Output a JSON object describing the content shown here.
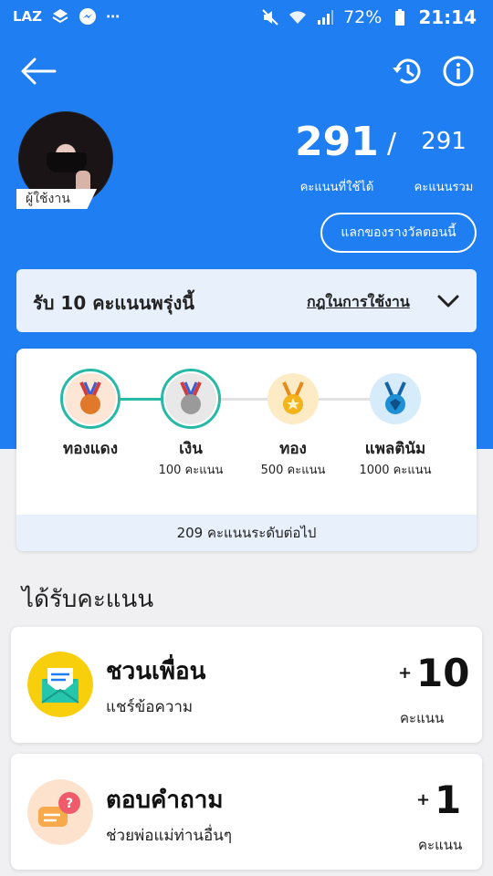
{
  "status_bar": {
    "time": "21:14",
    "battery": "72%",
    "carrier": "LAZ"
  },
  "profile": {
    "username": "ผู้ใช้งาน",
    "points_usable": "291",
    "separator": "/",
    "points_total": "291",
    "label_usable": "คะแนนที่ใช้ได้",
    "label_total": "คะแนนรวม",
    "redeem_label": "แลกของรางวัลตอนนี้"
  },
  "tomorrow": {
    "title": "รับ 10 คะแนนพรุ่งนี้",
    "rules_link": "กฎในการใช้งาน"
  },
  "tiers": [
    {
      "name": "ทองแดง",
      "points": "",
      "active": true,
      "color": "#e07a2a"
    },
    {
      "name": "เงิน",
      "points": "100 คะแนน",
      "active": true,
      "color": "#9a9a9a"
    },
    {
      "name": "ทอง",
      "points": "500 คะแนน",
      "active": false,
      "color": "#f2b31b"
    },
    {
      "name": "แพลตินัม",
      "points": "1000 คะแนน",
      "active": false,
      "color": "#1f8fd6"
    }
  ],
  "next_level": "209 คะแนนระดับต่อไป",
  "section_title": "ได้รับคะแนน",
  "earn_items": [
    {
      "title": "ชวนเพื่อน",
      "subtitle": "แชร์ข้อความ",
      "plus": "+",
      "points": "10",
      "unit": "คะแนน",
      "icon": "envelope-icon"
    },
    {
      "title": "ตอบคำถาม",
      "subtitle": "ช่วยพ่อแม่ท่านอื่นๆ",
      "plus": "+",
      "points": "1",
      "unit": "คะแนน",
      "icon": "question-chat-icon"
    }
  ],
  "colors": {
    "brand_blue": "#1f7ef2",
    "accent_teal": "#26b9a6",
    "light_blue": "#e8f1fb"
  }
}
